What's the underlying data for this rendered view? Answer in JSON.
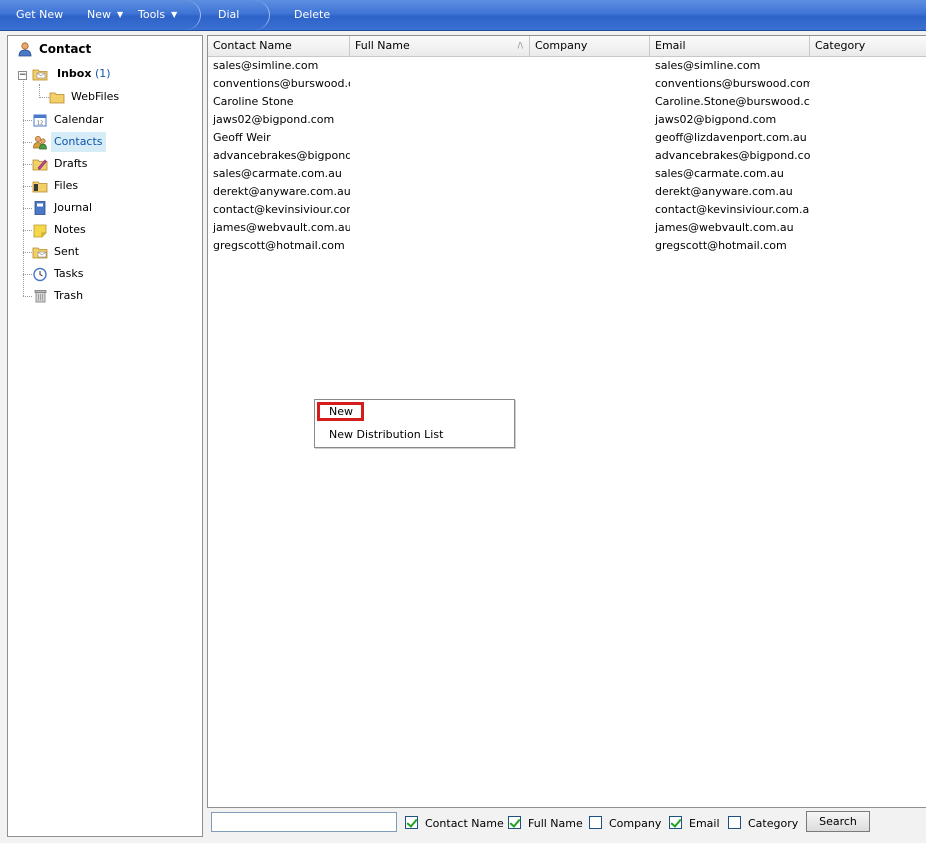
{
  "toolbar": {
    "get_new": "Get New",
    "new": "New",
    "tools": "Tools",
    "dial": "Dial",
    "delete": "Delete"
  },
  "nav": {
    "title": "Contact",
    "inbox_label": "Inbox",
    "inbox_count": "(1)",
    "webfiles": "WebFiles",
    "items": [
      "Calendar",
      "Contacts",
      "Drafts",
      "Files",
      "Journal",
      "Notes",
      "Sent",
      "Tasks",
      "Trash"
    ],
    "selected": "Contacts"
  },
  "list": {
    "columns": [
      "Contact Name",
      "Full Name",
      "Company",
      "Email",
      "Category"
    ],
    "sort_indicator": "/\\",
    "rows": [
      {
        "contact_name": "sales@simline.com",
        "full_name": "",
        "company": "",
        "email": "sales@simline.com",
        "category": ""
      },
      {
        "contact_name": "conventions@burswood.com",
        "full_name": "",
        "company": "",
        "email": "conventions@burswood.com.au",
        "category": ""
      },
      {
        "contact_name": "Caroline Stone",
        "full_name": "",
        "company": "",
        "email": "Caroline.Stone@burswood.com.",
        "category": ""
      },
      {
        "contact_name": "jaws02@bigpond.com",
        "full_name": "",
        "company": "",
        "email": "jaws02@bigpond.com",
        "category": ""
      },
      {
        "contact_name": "Geoff Weir",
        "full_name": "",
        "company": "",
        "email": "geoff@lizdavenport.com.au",
        "category": ""
      },
      {
        "contact_name": "advancebrakes@bigpond.cc",
        "full_name": "",
        "company": "",
        "email": "advancebrakes@bigpond.com",
        "category": ""
      },
      {
        "contact_name": "sales@carmate.com.au",
        "full_name": "",
        "company": "",
        "email": "sales@carmate.com.au",
        "category": ""
      },
      {
        "contact_name": "derekt@anyware.com.au",
        "full_name": "",
        "company": "",
        "email": "derekt@anyware.com.au",
        "category": ""
      },
      {
        "contact_name": "contact@kevinsiviour.com.a",
        "full_name": "",
        "company": "",
        "email": "contact@kevinsiviour.com.au",
        "category": ""
      },
      {
        "contact_name": "james@webvault.com.au",
        "full_name": "",
        "company": "",
        "email": "james@webvault.com.au",
        "category": ""
      },
      {
        "contact_name": "gregscott@hotmail.com",
        "full_name": "",
        "company": "",
        "email": "gregscott@hotmail.com",
        "category": ""
      }
    ]
  },
  "context_menu": {
    "items": [
      "New",
      "New Distribution List"
    ],
    "highlighted": "New",
    "highlight_color": "#d61d1d"
  },
  "search": {
    "input_value": "",
    "checkboxes": [
      {
        "label": "Contact Name",
        "checked": true
      },
      {
        "label": "Full Name",
        "checked": true
      },
      {
        "label": "Company",
        "checked": false
      },
      {
        "label": "Email",
        "checked": true
      },
      {
        "label": "Category",
        "checked": false
      }
    ],
    "button_label": "Search"
  },
  "colors": {
    "toolbar": "#3f74d6",
    "selected_nav_bg": "#d6ecf7",
    "inbox_count": "#1155aa"
  }
}
